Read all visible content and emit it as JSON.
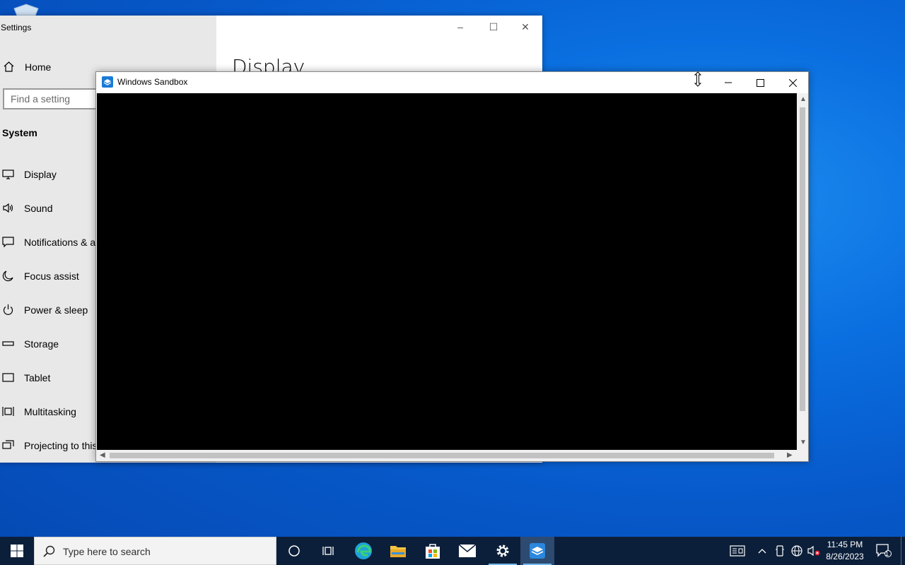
{
  "settings": {
    "title": "Settings",
    "heading": "Display",
    "home_label": "Home",
    "search_placeholder": "Find a setting",
    "section_label": "System",
    "nav_items": [
      {
        "label": "Display",
        "icon": "monitor-icon"
      },
      {
        "label": "Sound",
        "icon": "speaker-icon"
      },
      {
        "label": "Notifications & a",
        "icon": "notification-icon"
      },
      {
        "label": "Focus assist",
        "icon": "moon-icon"
      },
      {
        "label": "Power & sleep",
        "icon": "power-icon"
      },
      {
        "label": "Storage",
        "icon": "storage-icon"
      },
      {
        "label": "Tablet",
        "icon": "tablet-icon"
      },
      {
        "label": "Multitasking",
        "icon": "multitasking-icon"
      },
      {
        "label": "Projecting to this",
        "icon": "projecting-icon"
      }
    ]
  },
  "sandbox": {
    "title": "Windows Sandbox"
  },
  "taskbar": {
    "search_placeholder": "Type here to search",
    "time": "11:45 PM",
    "date": "8/26/2023",
    "notification_count": "1"
  },
  "colors": {
    "desktop": "#0a6fe0",
    "taskbar": "#0c1f3a",
    "accent": "#76b9ed"
  }
}
